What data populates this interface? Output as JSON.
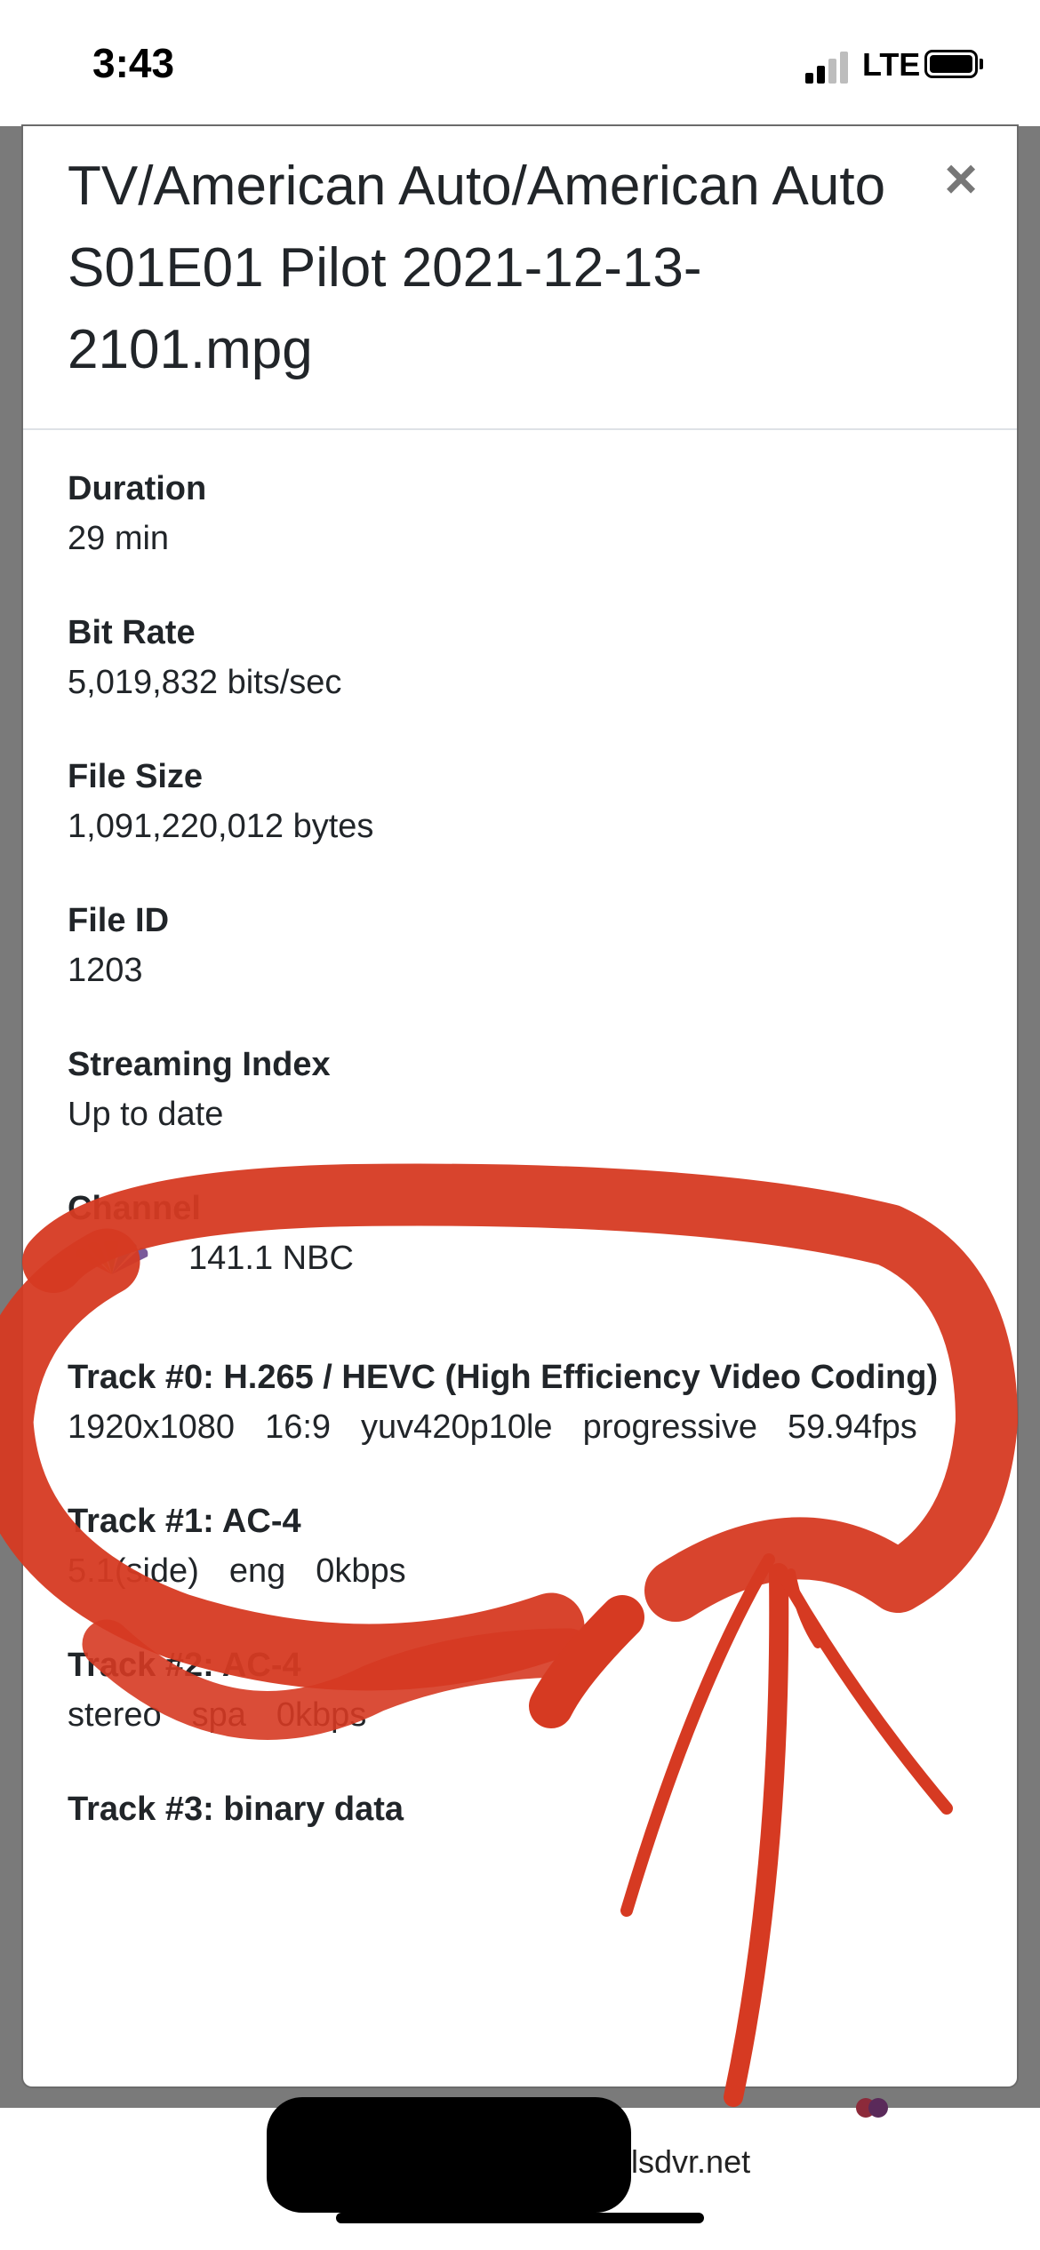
{
  "status_bar": {
    "time": "3:43",
    "network": "LTE"
  },
  "modal": {
    "title": "TV/American Auto/American Auto S01E01 Pilot 2021-12-13-2101.mpg",
    "close_symbol": "×",
    "fields": [
      {
        "label": "Duration",
        "value": "29 min"
      },
      {
        "label": "Bit Rate",
        "value": "5,019,832 bits/sec"
      },
      {
        "label": "File Size",
        "value": "1,091,220,012 bytes"
      },
      {
        "label": "File ID",
        "value": "1203"
      },
      {
        "label": "Streaming Index",
        "value": "Up to date"
      }
    ],
    "channel": {
      "label": "Channel",
      "value": "141.1 NBC",
      "logo_icon": "nbc-peacock-icon"
    },
    "tracks": [
      {
        "title": "Track #0: H.265 / HEVC (High Efficiency Video Coding)",
        "meta": [
          "1920x1080",
          "16:9",
          "yuv420p10le",
          "progressive",
          "59.94fps"
        ]
      },
      {
        "title": "Track #1: AC-4",
        "meta": [
          "5.1(side)",
          "eng",
          "0kbps"
        ]
      },
      {
        "title": "Track #2: AC-4",
        "meta": [
          "stereo",
          "spa",
          "0kbps"
        ]
      },
      {
        "title": "Track #3: binary data",
        "meta": []
      }
    ]
  },
  "url_bar": {
    "url_visible": "elsdvr.net"
  },
  "colors": {
    "annotation_red": "#d63a22",
    "backdrop": "#7a7a7a"
  }
}
